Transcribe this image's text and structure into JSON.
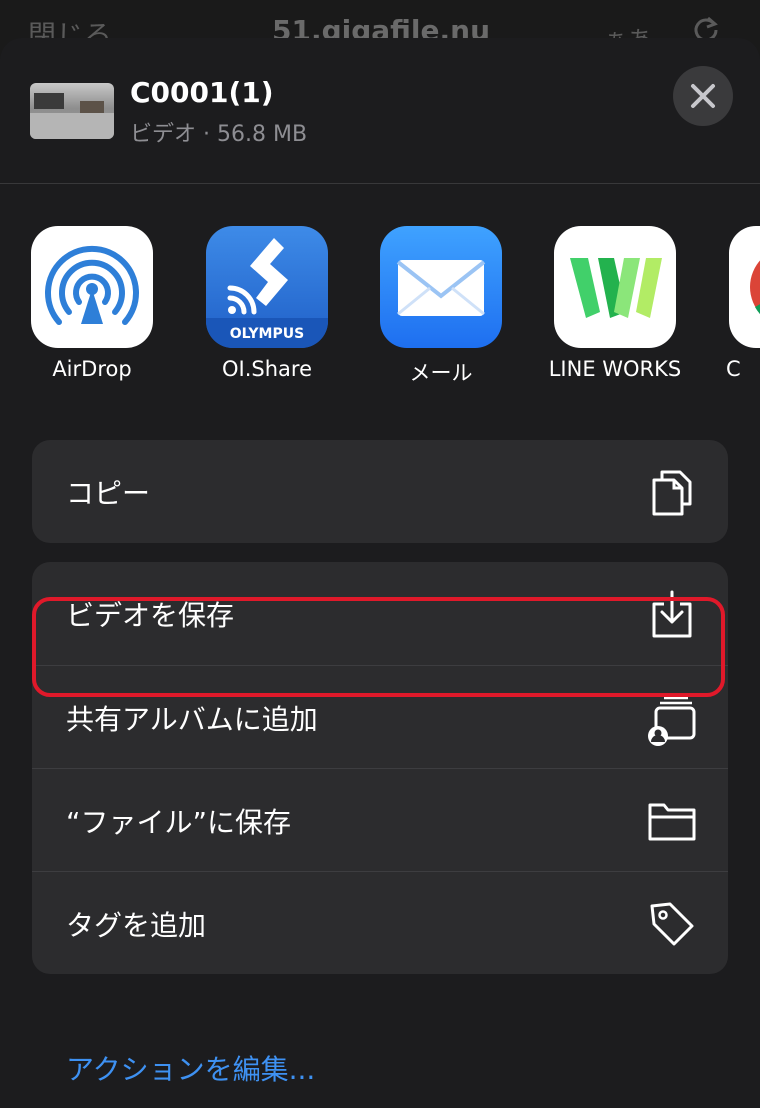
{
  "background_nav": {
    "close_label": "閉じる",
    "host": "51.gigafile.nu",
    "text_size_label": "ぁあ"
  },
  "header": {
    "file_name": "C0001(1)",
    "file_info": "ビデオ · 56.8 MB"
  },
  "apps": [
    {
      "label": "AirDrop",
      "icon": "airdrop-icon"
    },
    {
      "label": "OI.Share",
      "icon": "olympus-icon",
      "brand_text": "OLYMPUS"
    },
    {
      "label": "メール",
      "icon": "mail-icon"
    },
    {
      "label": "LINE WORKS",
      "icon": "line-works-icon"
    },
    {
      "label": "C",
      "icon": "chrome-icon"
    }
  ],
  "actions": {
    "copy": "コピー",
    "save_video": "ビデオを保存",
    "add_shared_album": "共有アルバムに追加",
    "save_to_files": "“ファイル”に保存",
    "add_tags": "タグを追加"
  },
  "edit_actions": "アクションを編集...",
  "colors": {
    "sheet_bg": "#1c1c1e",
    "row_bg": "#2c2c2e",
    "highlight": "#e0192a",
    "link": "#3e91f2"
  }
}
